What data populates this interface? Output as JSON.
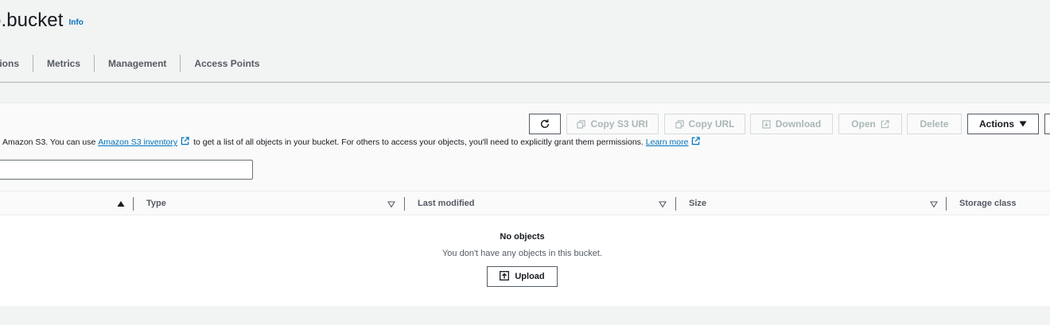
{
  "header": {
    "bucket_title": "o.bucket",
    "info_label": "Info"
  },
  "tabs": [
    {
      "label": "ssions"
    },
    {
      "label": "Metrics"
    },
    {
      "label": "Management"
    },
    {
      "label": "Access Points"
    }
  ],
  "toolbar": {
    "copy_s3_uri": "Copy S3 URI",
    "copy_url": "Copy URL",
    "download": "Download",
    "open": "Open",
    "delete": "Delete",
    "actions": "Actions"
  },
  "description": {
    "prefix": "Amazon S3. You can use",
    "inventory_link": "Amazon S3 inventory",
    "middle": "to get a list of all objects in your bucket. For others to access your objects, you'll need to explicitly grant them permissions.",
    "learn_more": "Learn more"
  },
  "search": {
    "value": ""
  },
  "table": {
    "columns": [
      "Type",
      "Last modified",
      "Size",
      "Storage class"
    ]
  },
  "empty_state": {
    "title": "No objects",
    "message": "You don't have any objects in this bucket.",
    "upload_label": "Upload"
  },
  "colors": {
    "link": "#0073bb",
    "text": "#16191f",
    "muted": "#545b64",
    "disabled": "#aab7b8"
  }
}
